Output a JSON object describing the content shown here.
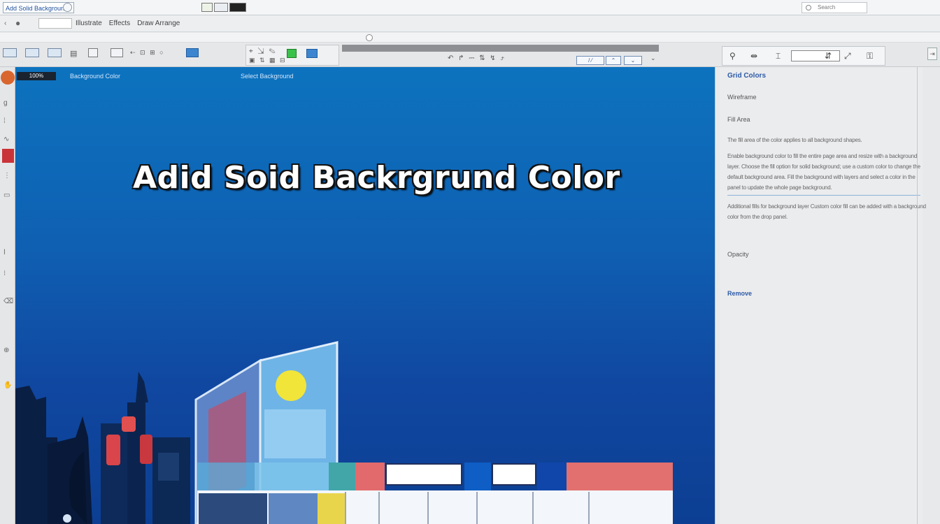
{
  "window": {
    "title": "Add Solid Background",
    "search_placeholder": "Search"
  },
  "menu": {
    "items": [
      "Illustrate",
      "Effects",
      "Draw Arrange"
    ]
  },
  "canvas": {
    "zoom": "100%",
    "label_left": "Background Color",
    "label_center": "Select Background",
    "headline": "Adid Soid Backrgrund Color",
    "background_colors": {
      "top": "#0d73bf",
      "bottom": "#0c3f93"
    }
  },
  "panel": {
    "title": "Grid Colors",
    "label_1": "Wireframe",
    "label_2": "Fill Area",
    "desc_1": "The fill area of the color applies to all background shapes.",
    "desc_2": "Enable background color to fill the entire page area and resize with a background layer. Choose the fill option for solid background; use a custom color to change the default background area. Fill the background with layers and select a color in the panel to update the whole page background.",
    "desc_3": "Additional fills for background layer Custom color fill can be added with a background color from the drop panel.",
    "label_3": "Opacity",
    "link": "Remove"
  },
  "icons": {
    "title_circle": "refresh-icon",
    "search": "search-icon",
    "menu": "menu-icon"
  }
}
